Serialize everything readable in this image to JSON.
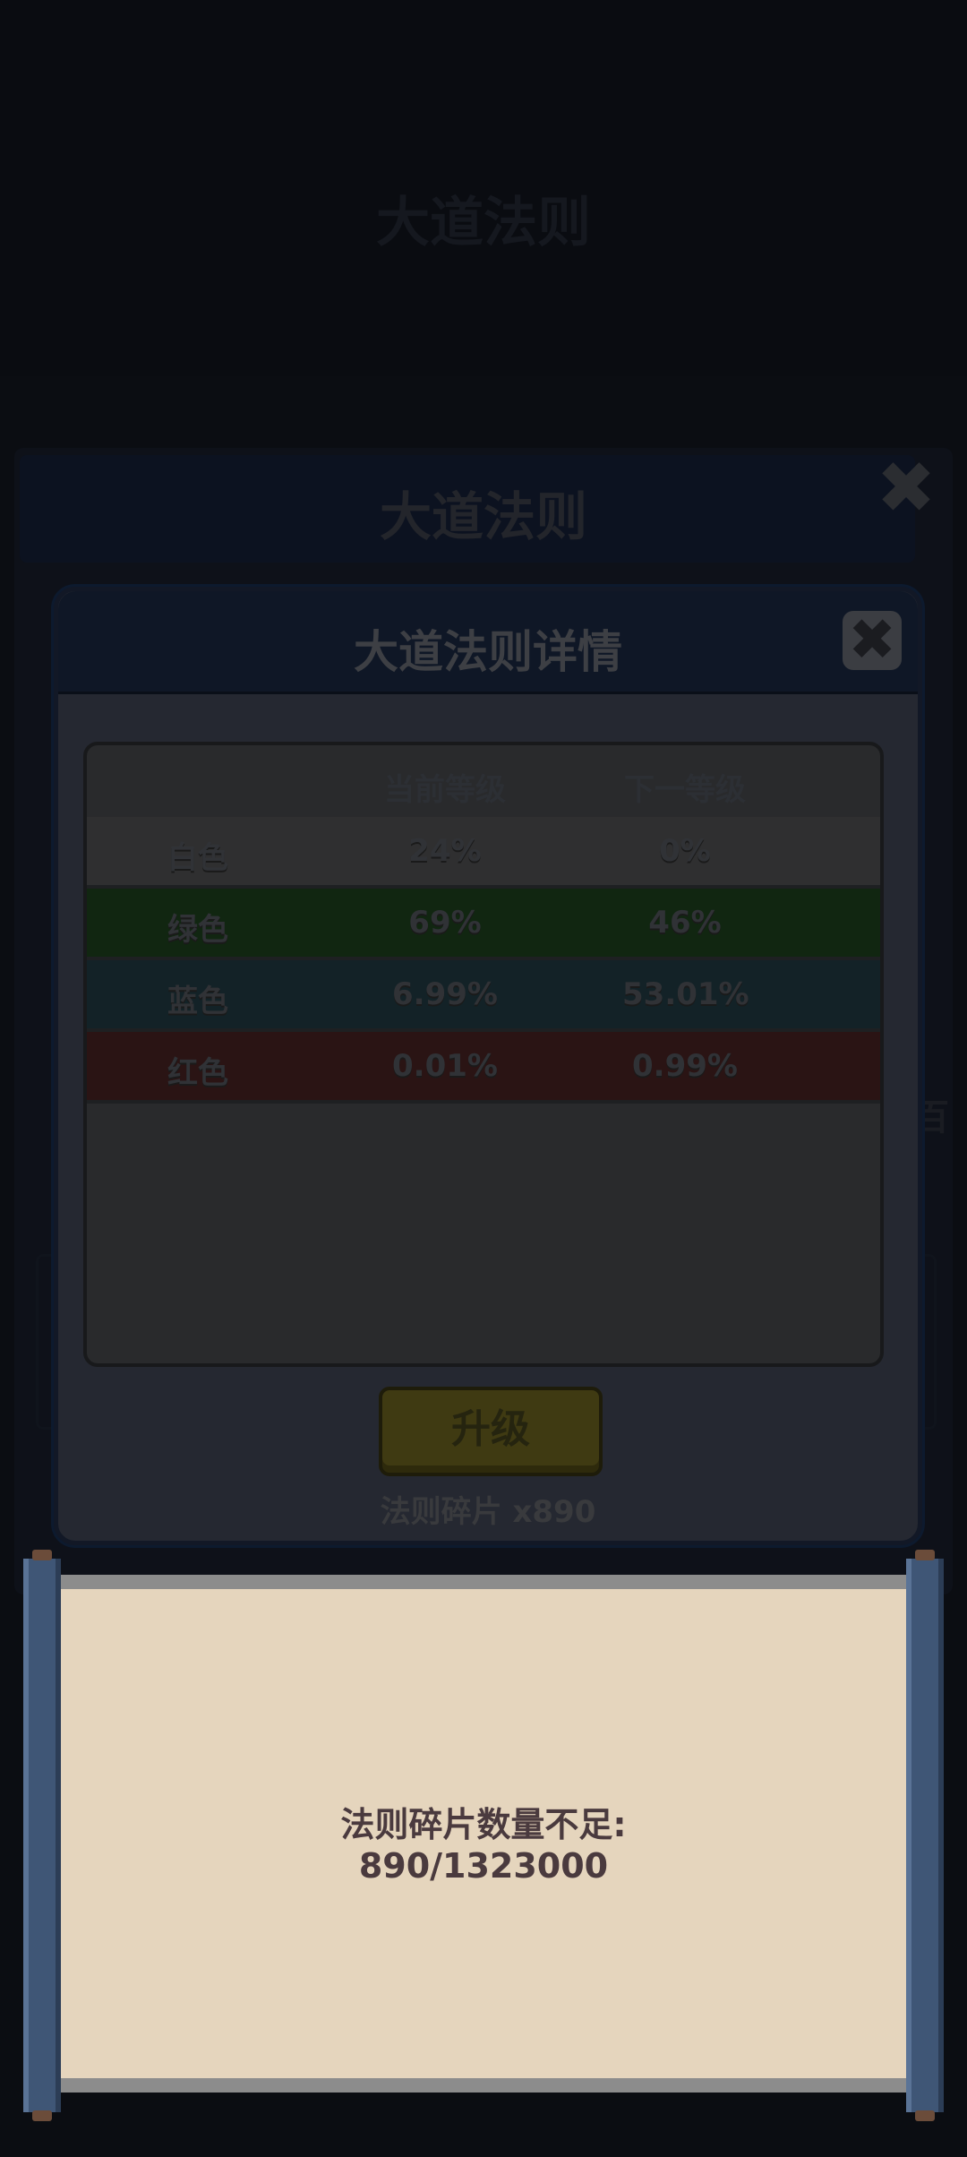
{
  "background": {
    "page_title": "大道法则",
    "page_subtitle": "",
    "panel_title": "大道法则",
    "side_text": "百"
  },
  "dialog": {
    "title": "大道法则详情",
    "close_icon": "close-x-icon",
    "columns": {
      "name": "",
      "current": "当前等级",
      "next": "下一等级"
    },
    "rows": [
      {
        "name": "白色",
        "current": "24%",
        "next": "0%",
        "color": "#2f2f30"
      },
      {
        "name": "绿色",
        "current": "69%",
        "next": "46%",
        "color": "#112611"
      },
      {
        "name": "蓝色",
        "current": "6.99%",
        "next": "53.01%",
        "color": "#132227"
      },
      {
        "name": "红色",
        "current": "0.01%",
        "next": "0.99%",
        "color": "#2a1414"
      }
    ],
    "upgrade_label": "升级",
    "fragments": "法则碎片 x890"
  },
  "toast": {
    "line1": "法则碎片数量不足:",
    "line2": "890/1323000"
  }
}
